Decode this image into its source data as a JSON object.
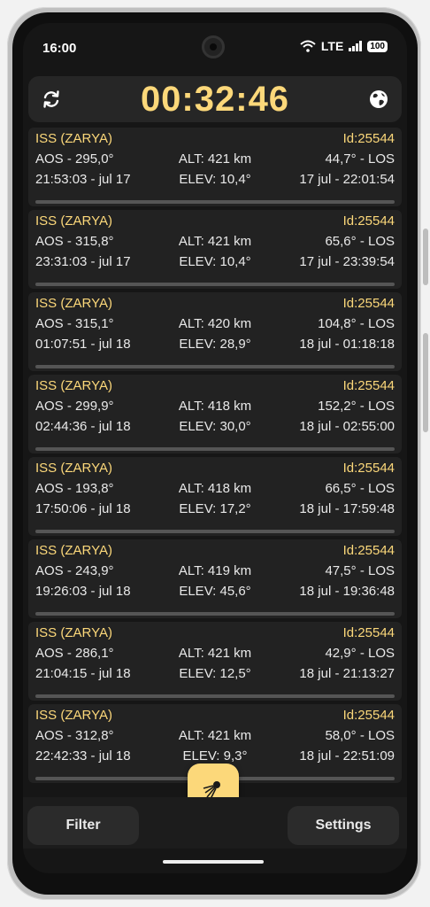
{
  "status_bar": {
    "time": "16:00",
    "network": "LTE",
    "battery": "100"
  },
  "header": {
    "timer": "00:32:46",
    "refresh_icon": "refresh-icon",
    "globe_icon": "globe-icon"
  },
  "passes": [
    {
      "name": "ISS (ZARYA)",
      "id": "Id:25544",
      "aos": "AOS - 295,0°",
      "alt": "ALT: 421 km",
      "los": "44,7° - LOS",
      "start": "21:53:03 - jul 17",
      "elev": "ELEV: 10,4°",
      "end": "17 jul - 22:01:54"
    },
    {
      "name": "ISS (ZARYA)",
      "id": "Id:25544",
      "aos": "AOS - 315,8°",
      "alt": "ALT: 421 km",
      "los": "65,6° - LOS",
      "start": "23:31:03 - jul 17",
      "elev": "ELEV: 10,4°",
      "end": "17 jul - 23:39:54"
    },
    {
      "name": "ISS (ZARYA)",
      "id": "Id:25544",
      "aos": "AOS - 315,1°",
      "alt": "ALT: 420 km",
      "los": "104,8° - LOS",
      "start": "01:07:51 - jul 18",
      "elev": "ELEV: 28,9°",
      "end": "18 jul - 01:18:18"
    },
    {
      "name": "ISS (ZARYA)",
      "id": "Id:25544",
      "aos": "AOS - 299,9°",
      "alt": "ALT: 418 km",
      "los": "152,2° - LOS",
      "start": "02:44:36 - jul 18",
      "elev": "ELEV: 30,0°",
      "end": "18 jul - 02:55:00"
    },
    {
      "name": "ISS (ZARYA)",
      "id": "Id:25544",
      "aos": "AOS - 193,8°",
      "alt": "ALT: 418 km",
      "los": "66,5° - LOS",
      "start": "17:50:06 - jul 18",
      "elev": "ELEV: 17,2°",
      "end": "18 jul - 17:59:48"
    },
    {
      "name": "ISS (ZARYA)",
      "id": "Id:25544",
      "aos": "AOS - 243,9°",
      "alt": "ALT: 419 km",
      "los": "47,5° - LOS",
      "start": "19:26:03 - jul 18",
      "elev": "ELEV: 45,6°",
      "end": "18 jul - 19:36:48"
    },
    {
      "name": "ISS (ZARYA)",
      "id": "Id:25544",
      "aos": "AOS - 286,1°",
      "alt": "ALT: 421 km",
      "los": "42,9° - LOS",
      "start": "21:04:15 - jul 18",
      "elev": "ELEV: 12,5°",
      "end": "18 jul - 21:13:27"
    },
    {
      "name": "ISS (ZARYA)",
      "id": "Id:25544",
      "aos": "AOS - 312,8°",
      "alt": "ALT: 421 km",
      "los": "58,0° - LOS",
      "start": "22:42:33 - jul 18",
      "elev": "ELEV: 9,3°",
      "end": "18 jul - 22:51:09"
    }
  ],
  "fab": {
    "icon": "satellite-icon"
  },
  "bottom_bar": {
    "filter_label": "Filter",
    "settings_label": "Settings"
  },
  "colors": {
    "accent": "#fcd87a",
    "card": "#222222",
    "background": "#161616"
  }
}
